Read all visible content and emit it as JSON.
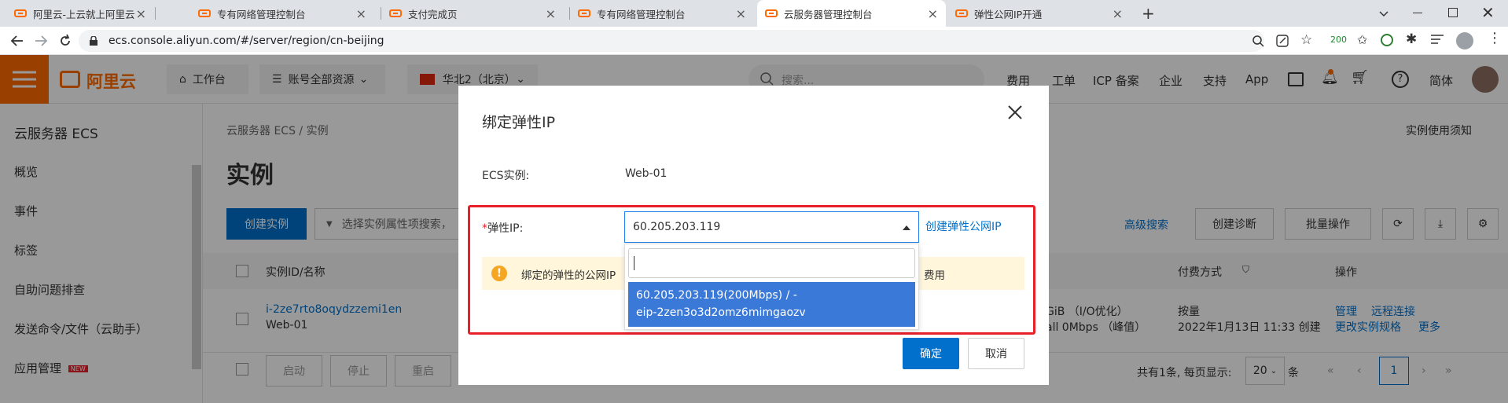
{
  "browser": {
    "tabs": [
      {
        "title": "阿里云-上云就上阿里云"
      },
      {
        "title": "专有网络管理控制台"
      },
      {
        "title": "支付完成页"
      },
      {
        "title": "专有网络管理控制台"
      },
      {
        "title": "云服务器管理控制台"
      },
      {
        "title": "弹性公网IP开通"
      }
    ],
    "active_tab": 4,
    "new_tab_glyph": "+",
    "url": "ecs.console.aliyun.com/#/server/region/cn-beijing",
    "extension_badge": "200"
  },
  "console_header": {
    "logo_text": "阿里云",
    "workbench": "工作台",
    "resources": "账号全部资源",
    "region": "华北2（北京）",
    "search_placeholder": "搜索...",
    "links": [
      "费用",
      "工单",
      "ICP 备案",
      "企业",
      "支持",
      "App"
    ],
    "lang": "简体"
  },
  "sidebar": {
    "title": "云服务器 ECS",
    "items": [
      {
        "label": "概览"
      },
      {
        "label": "事件"
      },
      {
        "label": "标签"
      },
      {
        "label": "自助问题排查"
      },
      {
        "label": "发送命令/文件（云助手）"
      },
      {
        "label": "应用管理",
        "badge": "NEW"
      }
    ]
  },
  "main": {
    "breadcrumb": "云服务器 ECS / 实例",
    "page_title": "实例",
    "notice_link": "实例使用须知",
    "create_button": "创建实例",
    "filter_placeholder": "选择实例属性项搜索，",
    "advanced_search": "高级搜索",
    "create_diagnosis": "创建诊断",
    "batch_ops": "批量操作",
    "table": {
      "headers": [
        "实例ID/名称",
        "付费方式",
        "操作"
      ],
      "row": {
        "id": "i-2ze7rto8oqydzzemi1en",
        "name": "Web-01",
        "spec_fragment": "GiB （I/O优化）",
        "bandwidth_fragment": "all   0Mbps （峰值）",
        "billing": "按量",
        "billing_time": "2022年1月13日 11:33 创建",
        "actions": [
          "管理",
          "远程连接",
          "更改实例规格",
          "更多"
        ]
      }
    },
    "footer_buttons": [
      "启动",
      "停止",
      "重启"
    ],
    "pagination": {
      "summary": "共有1条, 每页显示:",
      "page_size": "20",
      "unit": "条",
      "current_page": "1"
    }
  },
  "modal": {
    "title": "绑定弹性IP",
    "ecs_label": "ECS实例:",
    "ecs_value": "Web-01",
    "eip_label_required": "*",
    "eip_label": "弹性IP:",
    "eip_selected": "60.205.203.119",
    "create_eip_link": "创建弹性公网IP",
    "notice_text_left": "绑定的弹性的公网IP",
    "notice_text_right": "费用",
    "dropdown_search_value": "",
    "dropdown_option_line1": "60.205.203.119(200Mbps) / -",
    "dropdown_option_line2": "eip-2zen3o3d2omz6mimgaozv",
    "confirm": "确定",
    "cancel": "取消"
  },
  "colors": {
    "brand_orange": "#ff6a00",
    "primary_blue": "#0070cc",
    "highlight_red": "#e8202a",
    "option_selected_bg": "#3b79d8"
  }
}
